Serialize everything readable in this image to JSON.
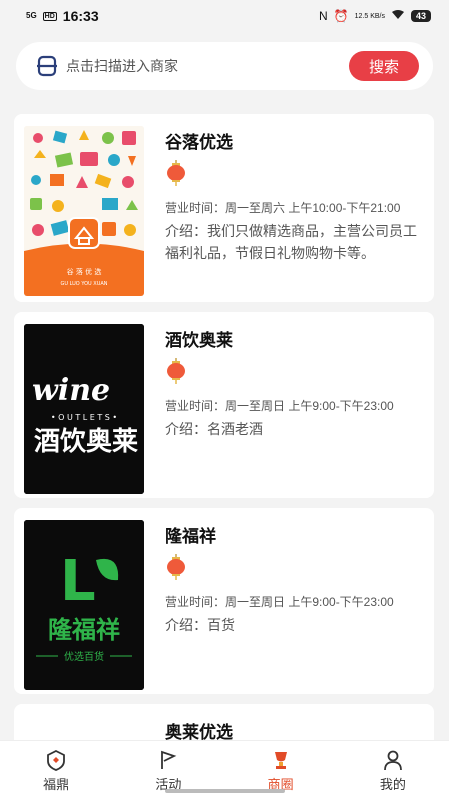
{
  "status": {
    "signal": "5G",
    "hd": "HD",
    "time": "16:33",
    "netspeed": "12.5 KB/s",
    "battery": "43"
  },
  "search": {
    "placeholder": "点击扫描进入商家",
    "button": "搜索"
  },
  "shops": [
    {
      "name": "谷落优选",
      "hours": "营业时间：周一至周六 上午10:00-下午21:00",
      "intro": "介绍：我们只做精选商品，主营公司员工福利礼品，节假日礼物购物卡等。",
      "logo_text": "谷 落 优 选",
      "logo_sub": "GU LUO YOU XUAN"
    },
    {
      "name": "酒饮奥莱",
      "hours": "营业时间：周一至周日 上午9:00-下午23:00",
      "intro": "介绍：名酒老酒",
      "logo_text": "wine",
      "logo_sub": "• O U T L E T S •",
      "logo_cn": "酒饮奥莱"
    },
    {
      "name": "隆福祥",
      "hours": "营业时间：周一至周日 上午9:00-下午23:00",
      "intro": "介绍：百货",
      "logo_text": "L",
      "logo_cn": "隆福祥",
      "logo_sub": "优选百货"
    },
    {
      "name": "奥莱优选"
    }
  ],
  "tabs": [
    {
      "label": "福鼎",
      "icon": "shield-icon"
    },
    {
      "label": "活动",
      "icon": "flag-icon"
    },
    {
      "label": "商圈",
      "icon": "trophy-icon",
      "active": true
    },
    {
      "label": "我的",
      "icon": "user-icon"
    }
  ],
  "colors": {
    "accent": "#e83f46",
    "tab_active": "#e14b28",
    "logo_green": "#2fb44a",
    "logo_orange": "#f37021"
  }
}
